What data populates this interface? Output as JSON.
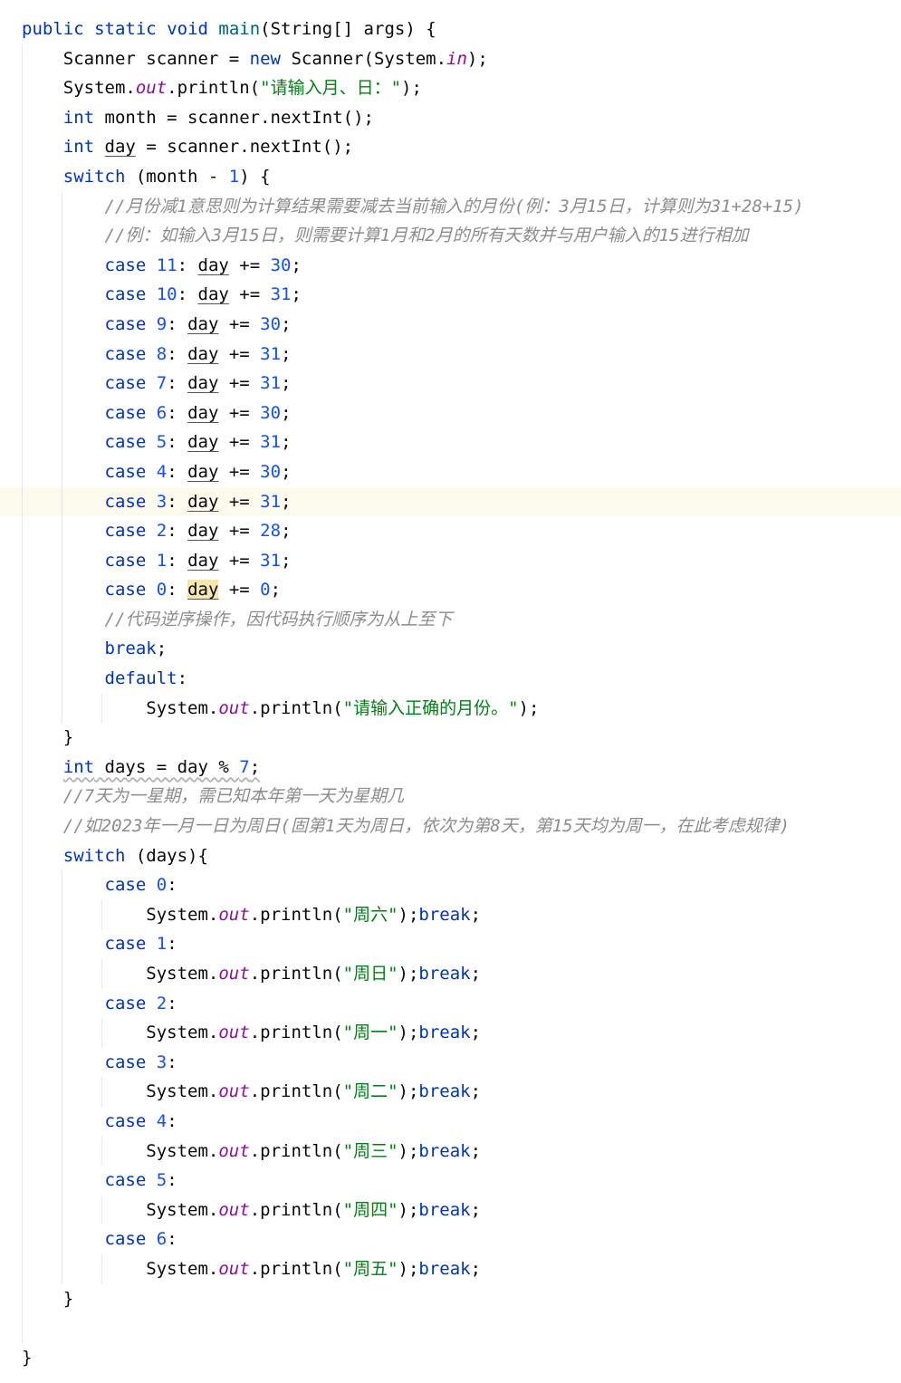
{
  "code": {
    "l1": {
      "kw1": "public",
      "kw2": "static",
      "kw3": "void",
      "fn": "main",
      "rest": "(String[] args) {"
    },
    "l2": {
      "a": "Scanner scanner = ",
      "kw": "new",
      "b": " Scanner(System.",
      "fld": "in",
      "c": ");"
    },
    "l3": {
      "a": "System.",
      "fld": "out",
      "b": ".println(",
      "str": "\"请输入月、日：\"",
      "c": ");"
    },
    "l4": {
      "kw": "int",
      "b": " month = scanner.nextInt();"
    },
    "l5": {
      "kw": "int",
      "sp": " ",
      "var": "day",
      "c": " = scanner.nextInt();"
    },
    "l6": {
      "kw": "switch",
      "a": " (month - ",
      "num": "1",
      "b": ") {"
    },
    "l7": {
      "cmt": "//月份减1意思则为计算结果需要减去当前输入的月份(例：3月15日，计算则为31+28+15)"
    },
    "l8": {
      "cmt": "//例：如输入3月15日，则需要计算1月和2月的所有天数并与用户输入的15进行相加"
    },
    "cases": [
      {
        "label": "11",
        "value": "30"
      },
      {
        "label": "10",
        "value": "31"
      },
      {
        "label": "9",
        "value": "30"
      },
      {
        "label": "8",
        "value": "31"
      },
      {
        "label": "7",
        "value": "31"
      },
      {
        "label": "6",
        "value": "30"
      },
      {
        "label": "5",
        "value": "31"
      },
      {
        "label": "4",
        "value": "30"
      },
      {
        "label": "3",
        "value": "31"
      },
      {
        "label": "2",
        "value": "28"
      },
      {
        "label": "1",
        "value": "31"
      },
      {
        "label": "0",
        "value": "0"
      }
    ],
    "case_kw": "case",
    "colon": ": ",
    "day_var": "day",
    "plus_eq": " += ",
    "semi": ";",
    "l21": {
      "cmt": "//代码逆序操作，因代码执行顺序为从上至下"
    },
    "l22": {
      "kw": "break",
      "c": ";"
    },
    "l23": {
      "kw": "default",
      "c": ":"
    },
    "l24": {
      "a": "System.",
      "fld": "out",
      "b": ".println(",
      "str": "\"请输入正确的月份。\"",
      "c": ");"
    },
    "l25": {
      "c": "}"
    },
    "l26": {
      "kw": "int",
      "a": " days = day % ",
      "num": "7",
      "c": ";"
    },
    "l27": {
      "cmt": "//7天为一星期，需已知本年第一天为星期几"
    },
    "l28": {
      "cmt": "//如2023年一月一日为周日(固第1天为周日，依次为第8天，第15天均为周一，在此考虑规律)"
    },
    "l29": {
      "kw": "switch",
      "c": " (days){"
    },
    "days": [
      {
        "label": "0",
        "name": "\"周六\""
      },
      {
        "label": "1",
        "name": "\"周日\""
      },
      {
        "label": "2",
        "name": "\"周一\""
      },
      {
        "label": "3",
        "name": "\"周二\""
      },
      {
        "label": "4",
        "name": "\"周三\""
      },
      {
        "label": "5",
        "name": "\"周四\""
      },
      {
        "label": "6",
        "name": "\"周五\""
      }
    ],
    "colon_only": ":",
    "sys": "System.",
    "out": "out",
    "println_open": ".println(",
    "close_break_semi": ");",
    "break_kw": "break",
    "l44": {
      "c": "}"
    },
    "l46": {
      "c": "}"
    }
  }
}
